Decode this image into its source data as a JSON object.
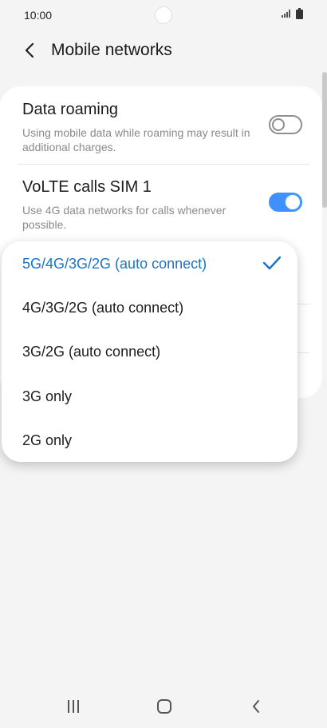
{
  "status_bar": {
    "time": "10:00"
  },
  "header": {
    "title": "Mobile networks"
  },
  "settings": [
    {
      "title": "Data roaming",
      "subtitle": "Using mobile data while roaming may result in additional charges.",
      "enabled": false
    },
    {
      "title": "VoLTE calls SIM 1",
      "subtitle": "Use 4G data networks for calls whenever possible.",
      "enabled": true
    }
  ],
  "network_mode_menu": {
    "options": [
      {
        "label": "5G/4G/3G/2G (auto connect)",
        "selected": true
      },
      {
        "label": "4G/3G/2G (auto connect)",
        "selected": false
      },
      {
        "label": "3G/2G (auto connect)",
        "selected": false
      },
      {
        "label": "3G only",
        "selected": false
      },
      {
        "label": "2G only",
        "selected": false
      }
    ]
  },
  "colors": {
    "accent": "#3e91ff",
    "selected_text": "#1a73c8",
    "background": "#f4f4f4"
  },
  "icons": {
    "back": "chevron-left-icon",
    "check": "checkmark-icon",
    "nav_recents": "recents-icon",
    "nav_home": "home-icon",
    "nav_back": "back-icon"
  }
}
